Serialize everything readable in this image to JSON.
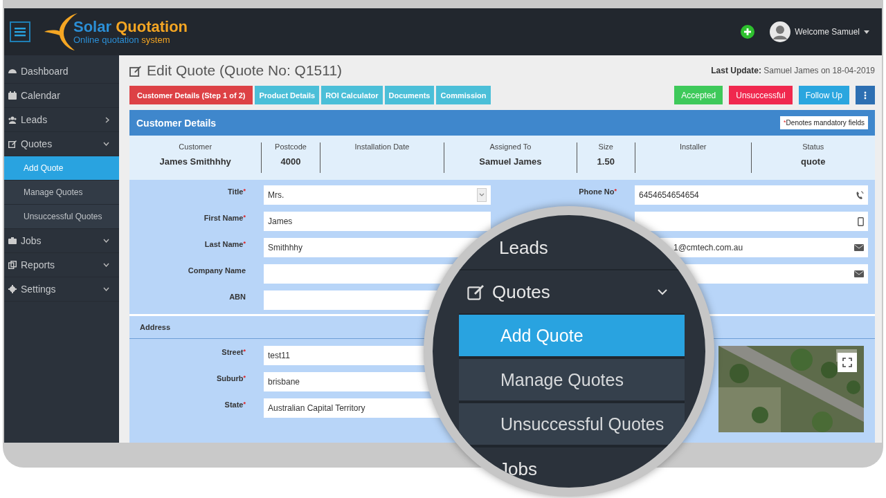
{
  "header": {
    "logo_title": [
      "Solar",
      "Quotation"
    ],
    "logo_subtitle": [
      "Online quotation",
      "system"
    ],
    "user": "Welcome Samuel"
  },
  "sidebar": {
    "items": [
      {
        "label": "Dashboard",
        "selected": false,
        "kind": "link"
      },
      {
        "label": "Calendar",
        "selected": false,
        "kind": "link"
      },
      {
        "label": "Leads",
        "selected": false,
        "kind": "flyout"
      },
      {
        "label": "Quotes",
        "selected": false,
        "kind": "dropdown",
        "expanded": true,
        "children": [
          {
            "label": "Add Quote",
            "selected": true
          },
          {
            "label": "Manage Quotes",
            "selected": false
          },
          {
            "label": "Unsuccessful Quotes",
            "selected": false
          }
        ]
      },
      {
        "label": "Jobs",
        "selected": false,
        "kind": "dropdown"
      },
      {
        "label": "Reports",
        "selected": false,
        "kind": "dropdown"
      },
      {
        "label": "Settings",
        "selected": false,
        "kind": "dropdown"
      }
    ]
  },
  "page": {
    "title": "Edit Quote (Quote No: Q1511)",
    "last_update": "**Last Update:** Samuel James on 18-04-2019"
  },
  "tabs": [
    {
      "label": "Customer Details (Step 1 of 2)",
      "selected": true
    },
    {
      "label": "Product Details",
      "selected": false
    },
    {
      "label": "ROI Calculator",
      "selected": false
    },
    {
      "label": "Documents",
      "selected": false
    },
    {
      "label": "Commission",
      "selected": false
    }
  ],
  "actions": [
    {
      "label": "Accepted",
      "color": "#3ec95a"
    },
    {
      "label": "Unsuccessful",
      "color": "#f0284e"
    },
    {
      "label": "Follow Up",
      "color": "#2aa6df"
    }
  ],
  "panel": {
    "title": "Customer Details",
    "note_mark": "*",
    "note": "Denotes mandatory fields"
  },
  "summary": [
    {
      "heading": "Customer",
      "value": "James Smithhhy"
    },
    {
      "heading": "Postcode",
      "value": "4000"
    },
    {
      "heading": "Installation Date"
    },
    {
      "heading": "Assigned To",
      "value": "Samuel James"
    },
    {
      "heading": "Size",
      "value": "1.50"
    },
    {
      "heading": "Installer"
    },
    {
      "heading": "Status",
      "value": "quote"
    }
  ],
  "form_left": [
    {
      "label": "Title",
      "mark": "*",
      "kind": "select",
      "value": "Mrs."
    },
    {
      "label": "First Name",
      "mark": "*",
      "kind": "text",
      "value": "James"
    },
    {
      "label": "Last Name",
      "mark": "*",
      "kind": "text",
      "value": "Smithhhy"
    },
    {
      "label": "Company Name",
      "kind": "text"
    },
    {
      "label": "ABN",
      "kind": "text"
    }
  ],
  "form_right": [
    {
      "label": "Phone No",
      "mark": "*",
      "kind": "phone",
      "value": "6454654654654"
    },
    {
      "kind": "mobile"
    },
    {
      "kind": "email",
      "value": "1@cmtech.com.au"
    },
    {
      "kind": "email"
    }
  ],
  "address": {
    "title": "Address",
    "fields": [
      {
        "label": "Street",
        "mark": "*",
        "value": "test11"
      },
      {
        "label": "Suburb",
        "mark": "*",
        "value": "brisbane"
      },
      {
        "label": "State",
        "mark": "*",
        "value": "Australian Capital Territory"
      }
    ]
  },
  "magnifier": {
    "items": [
      {
        "label": "Leads",
        "selected": false
      },
      {
        "label": "Quotes",
        "selected": false,
        "expanded": true,
        "children": [
          {
            "label": "Add Quote",
            "selected": true
          },
          {
            "label": "Manage Quotes",
            "selected": false
          },
          {
            "label": "Unsuccessful Quotes",
            "selected": false
          }
        ]
      },
      {
        "label": "Jobs",
        "selected": false
      }
    ]
  }
}
